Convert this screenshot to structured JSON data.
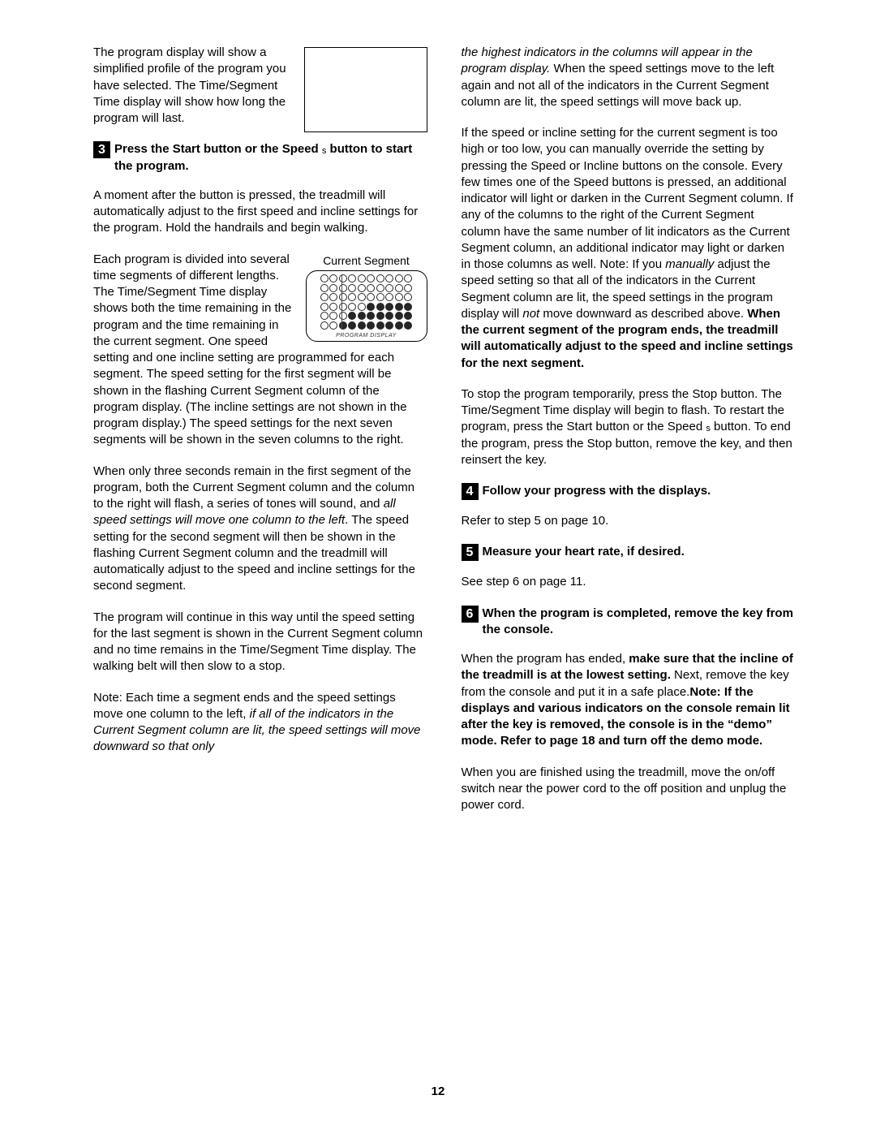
{
  "page_number": "12",
  "left": {
    "intro": "The program display will show a simplified profile of the program you have selected. The Time/Segment Time display will show how long the program will last.",
    "step3_num": "3",
    "step3_title_a": "Press the Start button or the Speed ",
    "step3_title_s": "s",
    "step3_title_b": "  button to start the program.",
    "p1": "A moment after the button is pressed, the tread­mill will automatically adjust to the first speed and incline settings for the program. Hold the handrails and begin walking.",
    "p2a": "Each program is divided into several time seg­ments of different lengths. The Time/Segment Time display shows both the time remaining in the program and the time remaining in the current segment. One speed setting and one incline setting are programmed for each segment. The speed setting for the first segment will be shown in the flashing Current Segment column of the program display. (The incline settings are not shown in the program display.) The speed settings for the next seven segments will be shown in the seven columns to the right.",
    "seg_label": "Current Segment",
    "seg_caption": "PROGRAM DISPLAY",
    "p3a": "When only three seconds remain in the first seg­ment of the program, both the Current Segment column and the column to the right will flash, a se­ries of tones will sound, and ",
    "p3i": "all speed settings will move one column to the left",
    "p3b": ". The speed setting for the second segment will then be shown in the flashing Current Segment column and the tread­mill will automatically adjust to the speed and in­cline settings for the second segment.",
    "p4": "The program will continue in this way until the speed setting for the last segment is shown in the Current Segment column and no time remains in the Time/Segment Time display. The walking belt will then slow to a stop.",
    "p5a": "Note: Each time a segment ends and the speed settings move one column to the left, ",
    "p5i": "if all of the indicators in the Current Segment column are lit, the speed settings will move downward so that only"
  },
  "right": {
    "r0i": "the highest indicators in the columns will appear in the program display.",
    "r0b": " When the speed settings move to the left again and not all of the indicators in the Current Segment column are lit, the speed settings will move back up.",
    "r1a": "If the speed or incline setting for the current segment is too high or too low, you can manually override the setting by pressing the Speed or Incline buttons on the console. Every few times one of the Speed buttons is pressed, an additional indicator will light or darken in the Current Segment column. If any of the columns to the right of the Current Segment column have the same number of lit indicators as the Current Segment column, an additional indicator may light or darken in those columns as well. Note: If you ",
    "r1i1": "manually",
    "r1b": " adjust the speed setting so that all of the indicators in the Current Segment column are lit, the speed settings in the program display will ",
    "r1i2": "not",
    "r1c": " move downward as described above. ",
    "r1bold": "When the current segment of the program ends, the treadmill will automati­cally adjust to the speed and incline settings for the next segment.",
    "r2a": "To stop the program temporarily, press the Stop button. The Time/Segment Time display will begin to flash. To restart the program, press the Start but­ton or the Speed ",
    "r2s": "s",
    "r2b": " button. To end the program, press the Stop button, remove the key, and then reinsert the key.",
    "step4_num": "4",
    "step4_title": "Follow your progress with the displays.",
    "step4_body": "Refer to step 5 on page 10.",
    "step5_num": "5",
    "step5_title": "Measure your heart rate, if desired.",
    "step5_body": "See step 6 on page 11.",
    "step6_num": "6",
    "step6_title": "When the program is completed, remove the key from the console.",
    "step6_p1a": "When the program has ended, ",
    "step6_p1b": "make sure that the incline of the treadmill is at the lowest set­ting.",
    "step6_p1c": " Next, remove the key from the console and put it in a safe place.",
    "step6_p1d": "Note: If the displays and various indicators on the console remain lit after the key is removed, the console is in the “demo” mode. Refer to page 18 and turn off the demo mode.",
    "step6_p2": "When you are finished using the treadmill, move the on/off switch near the power cord to the off position and unplug the power cord."
  },
  "chart_data": {
    "type": "heatmap",
    "title": "Program Display — Current Segment",
    "columns": 10,
    "rows": 6,
    "legend": [
      "open",
      "filled"
    ],
    "current_segment_column_index": 2,
    "grid": [
      [
        0,
        0,
        0,
        0,
        0,
        0,
        0,
        0,
        0,
        0
      ],
      [
        0,
        0,
        0,
        0,
        0,
        0,
        0,
        0,
        0,
        0
      ],
      [
        0,
        0,
        0,
        0,
        0,
        0,
        0,
        0,
        0,
        0
      ],
      [
        0,
        0,
        0,
        0,
        0,
        1,
        1,
        1,
        1,
        1
      ],
      [
        0,
        0,
        0,
        1,
        1,
        1,
        1,
        1,
        1,
        1
      ],
      [
        0,
        0,
        1,
        1,
        1,
        1,
        1,
        1,
        1,
        1
      ]
    ]
  }
}
